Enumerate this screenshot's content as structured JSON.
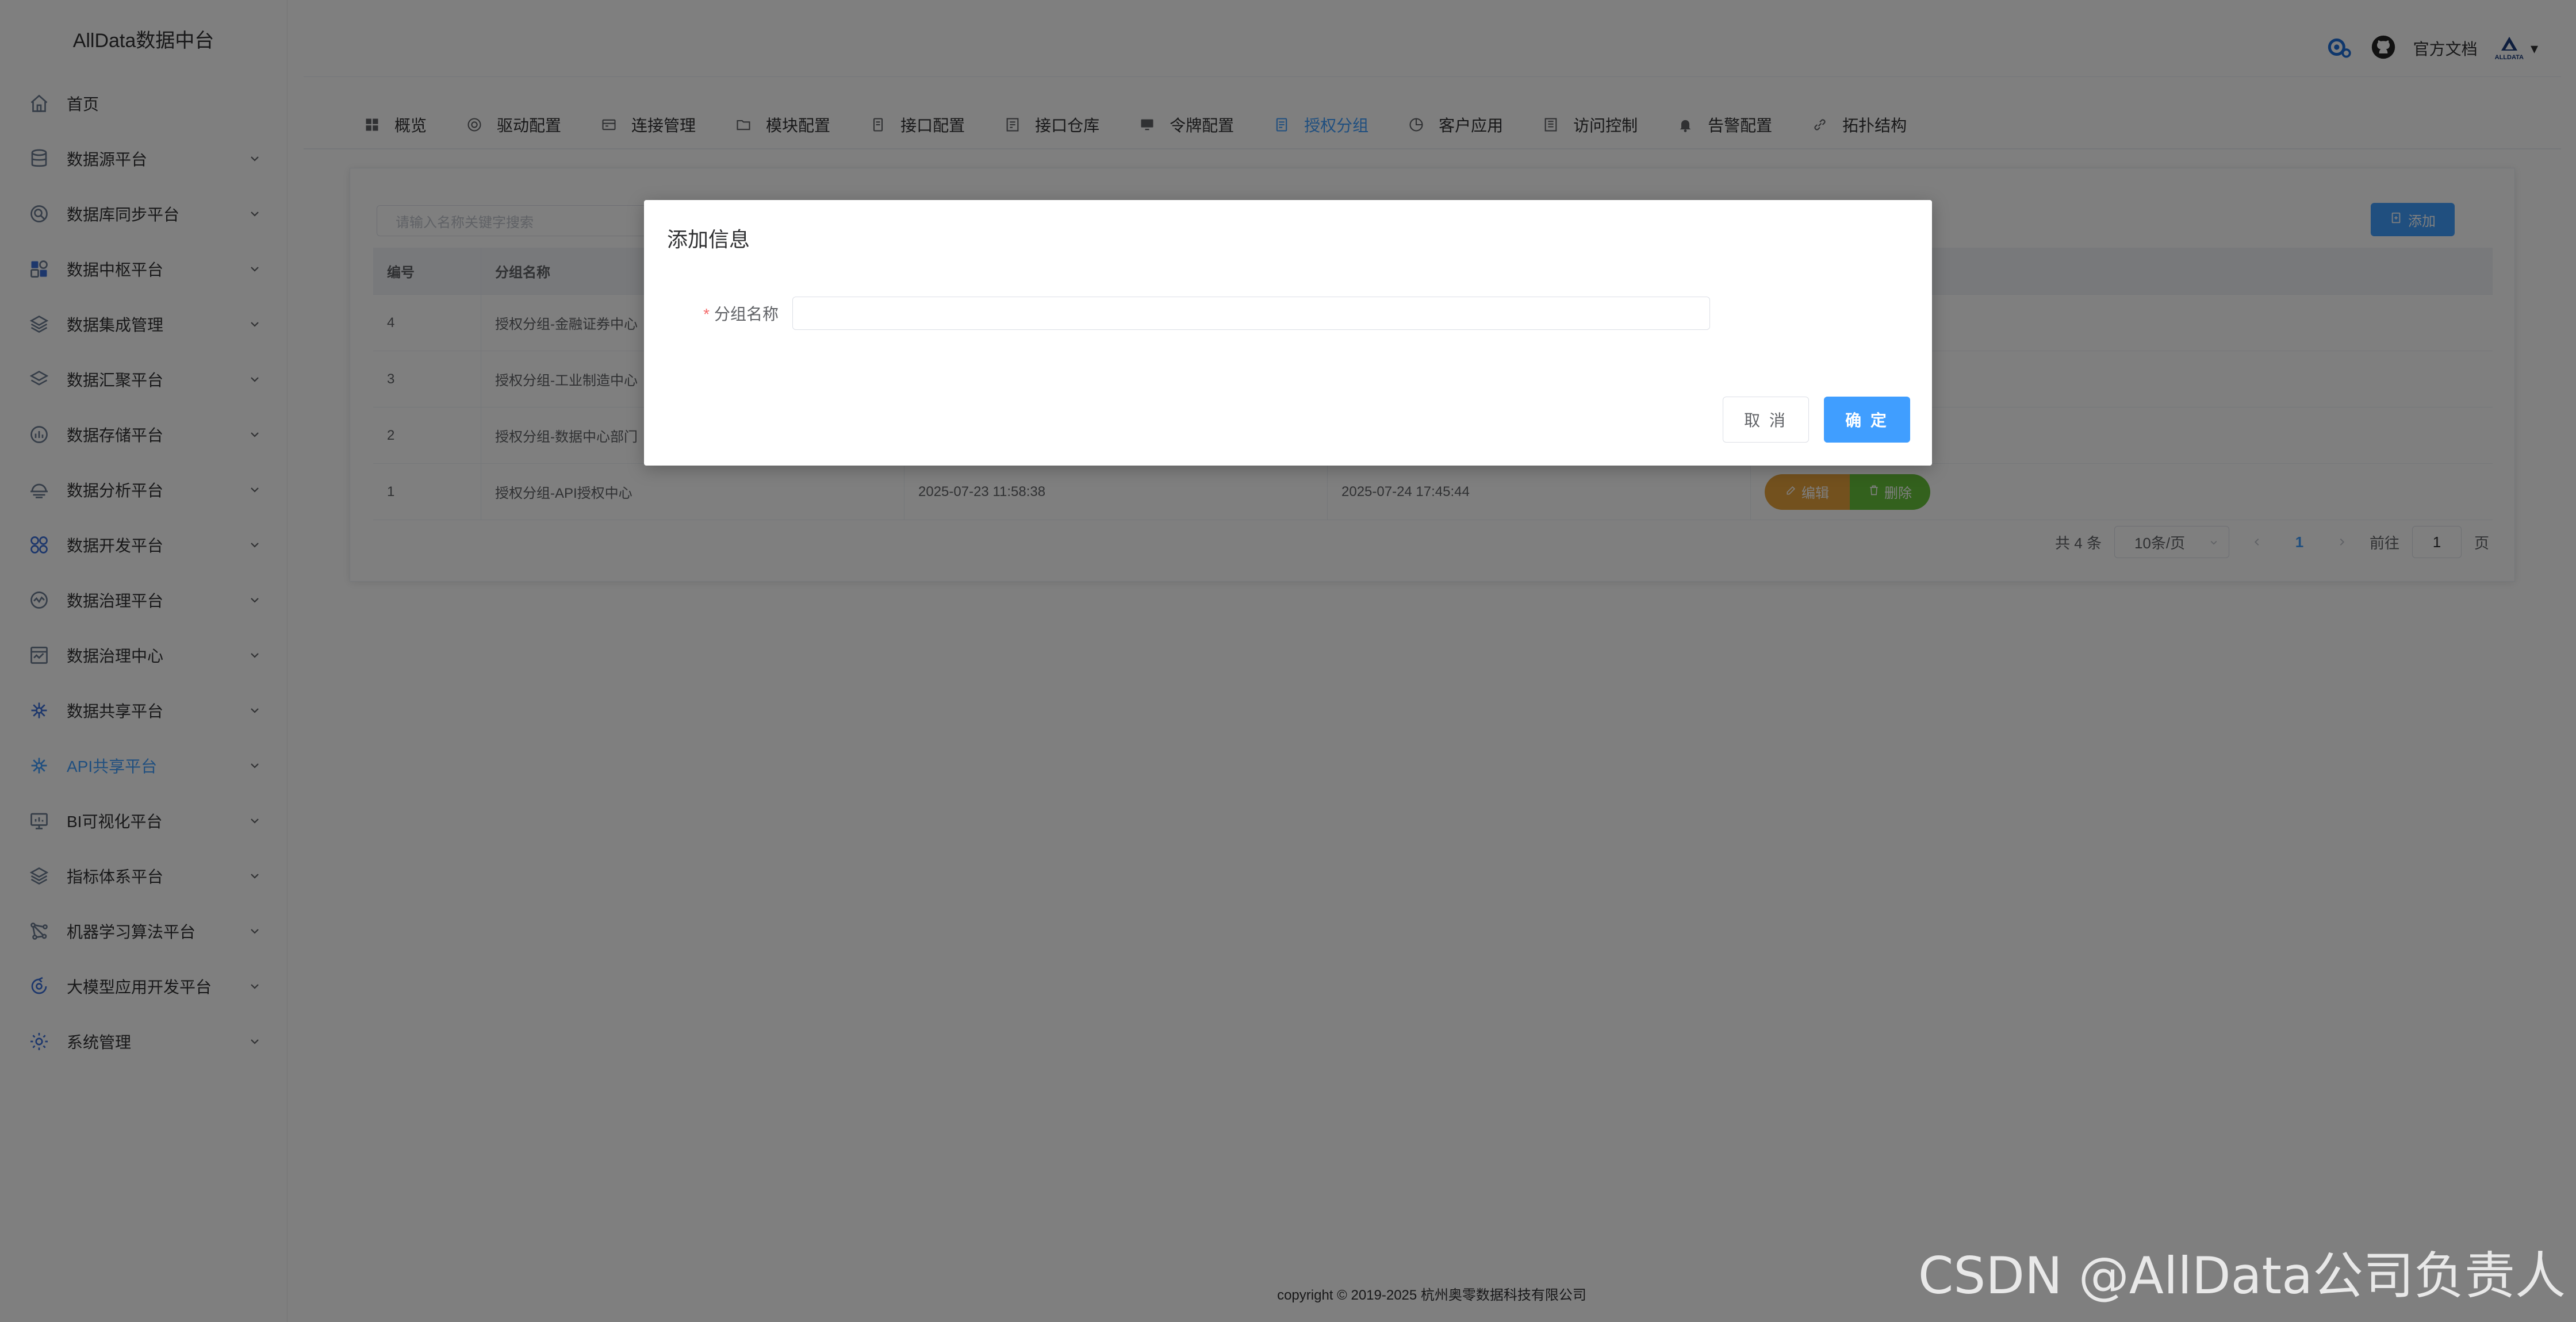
{
  "app": {
    "title": "AllData数据中台"
  },
  "sidebar": {
    "items": [
      {
        "label": "首页",
        "icon": "home-icon",
        "has_arrow": false
      },
      {
        "label": "数据源平台",
        "icon": "database-icon",
        "has_arrow": true
      },
      {
        "label": "数据库同步平台",
        "icon": "sync-icon",
        "has_arrow": true
      },
      {
        "label": "数据中枢平台",
        "icon": "hub-icon",
        "has_arrow": true
      },
      {
        "label": "数据集成管理",
        "icon": "integration-icon",
        "has_arrow": true
      },
      {
        "label": "数据汇聚平台",
        "icon": "layers-icon",
        "has_arrow": true
      },
      {
        "label": "数据存储平台",
        "icon": "storage-icon",
        "has_arrow": true
      },
      {
        "label": "数据分析平台",
        "icon": "analysis-icon",
        "has_arrow": true
      },
      {
        "label": "数据开发平台",
        "icon": "develop-icon",
        "has_arrow": true
      },
      {
        "label": "数据治理平台",
        "icon": "governance-icon",
        "has_arrow": true
      },
      {
        "label": "数据治理中心",
        "icon": "governance-center-icon",
        "has_arrow": true
      },
      {
        "label": "数据共享平台",
        "icon": "share-icon",
        "has_arrow": true
      },
      {
        "label": "API共享平台",
        "icon": "api-share-icon",
        "has_arrow": true,
        "active": true
      },
      {
        "label": "BI可视化平台",
        "icon": "bi-icon",
        "has_arrow": true
      },
      {
        "label": "指标体系平台",
        "icon": "metrics-icon",
        "has_arrow": true
      },
      {
        "label": "机器学习算法平台",
        "icon": "ml-icon",
        "has_arrow": true
      },
      {
        "label": "大模型应用开发平台",
        "icon": "llm-icon",
        "has_arrow": true
      },
      {
        "label": "系统管理",
        "icon": "system-icon",
        "has_arrow": true
      }
    ]
  },
  "header": {
    "doc_link": "官方文档",
    "logo_text": "ALLDATA",
    "dropdown": "▾"
  },
  "tabs": [
    {
      "label": "概览",
      "icon": "grid-icon"
    },
    {
      "label": "驱动配置",
      "icon": "driver-icon"
    },
    {
      "label": "连接管理",
      "icon": "connection-icon"
    },
    {
      "label": "模块配置",
      "icon": "folder-icon"
    },
    {
      "label": "接口配置",
      "icon": "interface-icon"
    },
    {
      "label": "接口仓库",
      "icon": "repository-icon"
    },
    {
      "label": "令牌配置",
      "icon": "token-icon"
    },
    {
      "label": "授权分组",
      "icon": "document-icon",
      "active": true
    },
    {
      "label": "客户应用",
      "icon": "pie-icon"
    },
    {
      "label": "访问控制",
      "icon": "list-icon"
    },
    {
      "label": "告警配置",
      "icon": "bell-icon"
    },
    {
      "label": "拓扑结构",
      "icon": "link-icon"
    }
  ],
  "toolbar": {
    "search_placeholder": "请输入名称关键字搜索",
    "add_label": "添加"
  },
  "table": {
    "headers": [
      "编号",
      "分组名称",
      "",
      "",
      ""
    ],
    "rows": [
      {
        "id": "4",
        "name": "授权分组-金融证券中心",
        "created": "",
        "updated": ""
      },
      {
        "id": "3",
        "name": "授权分组-工业制造中心",
        "created": "",
        "updated": ""
      },
      {
        "id": "2",
        "name": "授权分组-数据中心部门",
        "created": "",
        "updated": ""
      },
      {
        "id": "1",
        "name": "授权分组-API授权中心",
        "created": "2025-07-23 11:58:38",
        "updated": "2025-07-24 17:45:44"
      }
    ],
    "edit_label": "编辑",
    "delete_label": "删除"
  },
  "pagination": {
    "total": "共 4 条",
    "page_size": "10条/页",
    "current": "1",
    "goto": "前往",
    "goto_value": "1",
    "page_unit": "页"
  },
  "footer": {
    "copyright": "copyright © 2019-2025 杭州奥零数据科技有限公司"
  },
  "dialog": {
    "title": "添加信息",
    "required_mark": "*",
    "field_label": "分组名称",
    "field_value": "",
    "cancel_label": "取 消",
    "ok_label": "确 定"
  },
  "watermark": "CSDN @AllData公司负责人",
  "colors": {
    "primary": "#409eff",
    "warning": "#e6a23c",
    "success": "#67c23a",
    "danger": "#f56c6c"
  }
}
